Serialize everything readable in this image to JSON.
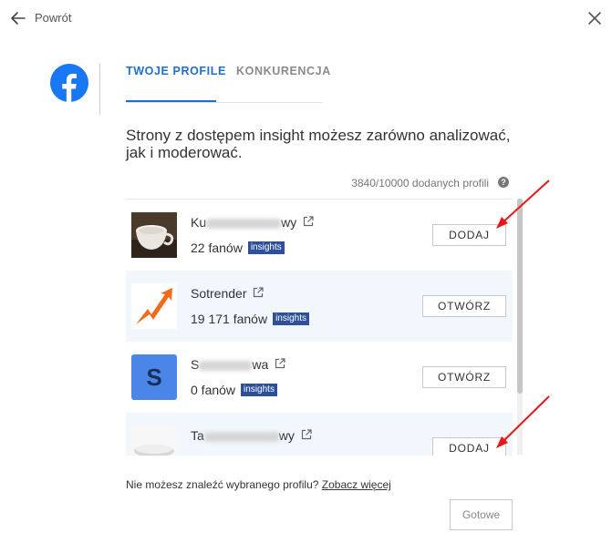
{
  "header": {
    "back_label": "Powrót"
  },
  "tabs": {
    "active": "TWOJE PROFILE",
    "inactive": "KONKURENCJA"
  },
  "description": "Strony z dostępem insight możesz zarówno analizować, jak i moderować.",
  "counter": "3840/10000 dodanych profili",
  "badge_label": "insights",
  "profiles": [
    {
      "name_start": "Ku",
      "name_end": "wy",
      "fans": "22 fanów",
      "button": "DODAJ",
      "avatar": "cup-image"
    },
    {
      "name_start": "Sotrender",
      "name_end": "",
      "fans": "19 171 fanów",
      "button": "OTWÓRZ",
      "avatar": "sotrender-logo"
    },
    {
      "name_start": "S",
      "name_end": "wa",
      "fans": "0 fanów",
      "button": "OTWÓRZ",
      "avatar": "letter-s-avatar"
    },
    {
      "name_start": "Ta",
      "name_end": "wy",
      "fans": "",
      "button": "DODAJ",
      "avatar": "dish-image"
    }
  ],
  "avatar_letter": "S",
  "footer": {
    "note": "Nie możesz znaleźć wybranego profilu?",
    "link": "Zobacz więcej"
  },
  "done_label": "Gotowe",
  "colors": {
    "accent": "#1f6fd1",
    "badge": "#2d4f9c",
    "arrow": "#e8171c"
  }
}
